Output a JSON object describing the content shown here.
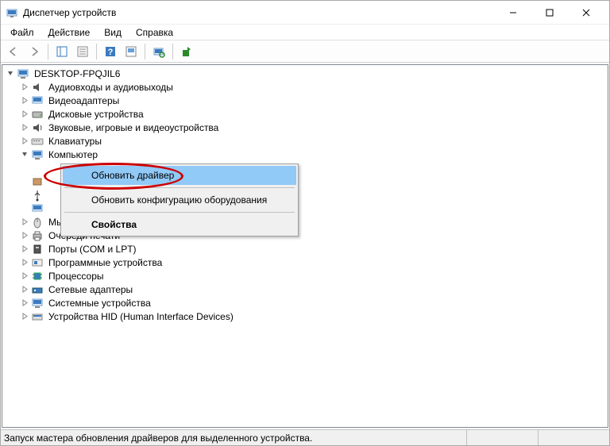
{
  "window": {
    "title": "Диспетчер устройств"
  },
  "menu": {
    "file": "Файл",
    "action": "Действие",
    "view": "Вид",
    "help": "Справка"
  },
  "tree": {
    "root": "DESKTOP-FPQJIL6",
    "items": [
      "Аудиовходы и аудиовыходы",
      "Видеоадаптеры",
      "Дисковые устройства",
      "Звуковые, игровые и видеоустройства",
      "Клавиатуры",
      "Компьютер"
    ],
    "after_menu": [
      "Мыши и иные указывающие устройства",
      "Очереди печати",
      "Порты (COM и LPT)",
      "Программные устройства",
      "Процессоры",
      "Сетевые адаптеры",
      "Системные устройства",
      "Устройства HID (Human Interface Devices)"
    ]
  },
  "context_menu": {
    "update_driver": "Обновить драйвер",
    "scan_hardware": "Обновить конфигурацию оборудования",
    "properties": "Свойства"
  },
  "statusbar": {
    "text": "Запуск мастера обновления драйверов для выделенного устройства."
  }
}
